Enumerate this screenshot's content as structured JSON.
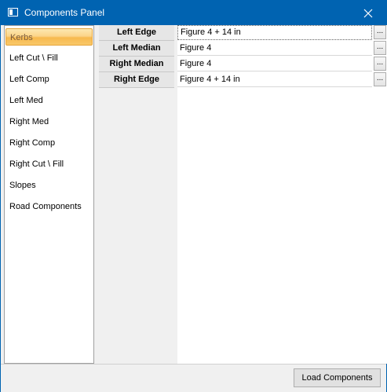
{
  "window": {
    "title": "Components Panel",
    "title_bar_color": "#0063b1",
    "icons": {
      "app": "window-app-icon",
      "close": "close-icon"
    }
  },
  "sidebar": {
    "items": [
      {
        "label": "Kerbs",
        "selected": true
      },
      {
        "label": "Left Cut \\ Fill"
      },
      {
        "label": "Left Comp"
      },
      {
        "label": "Left Med"
      },
      {
        "label": "Right Med"
      },
      {
        "label": "Right Comp"
      },
      {
        "label": "Right Cut \\ Fill"
      },
      {
        "label": "Slopes"
      },
      {
        "label": "Road Components"
      }
    ],
    "selected_color": "#f9c86a"
  },
  "properties": {
    "rows": [
      {
        "label": "Left Edge",
        "value": "Figure 4 + 14 in",
        "button": "..."
      },
      {
        "label": "Left Median",
        "value": "Figure 4",
        "button": "..."
      },
      {
        "label": "Right Median",
        "value": "Figure 4",
        "button": "..."
      },
      {
        "label": "Right Edge",
        "value": "Figure 4 + 14 in",
        "button": "..."
      }
    ]
  },
  "footer": {
    "load_button": "Load Components"
  }
}
